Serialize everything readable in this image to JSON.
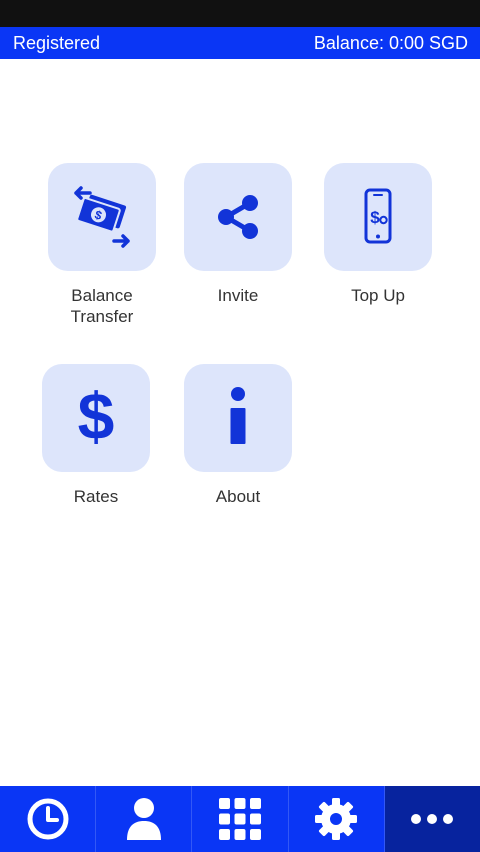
{
  "header": {
    "status": "Registered",
    "balance": "Balance: 0:00 SGD"
  },
  "tiles": [
    {
      "label_line1": "Balance",
      "label_line2": "Transfer",
      "icon": "money-transfer-icon"
    },
    {
      "label": "Invite",
      "icon": "share-icon"
    },
    {
      "label": "Top Up",
      "icon": "phone-dollar-icon"
    },
    {
      "label": "Rates",
      "icon": "dollar-icon"
    },
    {
      "label": "About",
      "icon": "info-icon"
    }
  ],
  "tabbar": {
    "items": [
      {
        "icon": "clock-icon"
      },
      {
        "icon": "person-icon"
      },
      {
        "icon": "dialpad-icon"
      },
      {
        "icon": "gear-icon"
      },
      {
        "icon": "more-icon",
        "active": true
      }
    ]
  },
  "colors": {
    "accent": "#0a36f5",
    "tile_bg": "#dde5fb",
    "active_tab": "#07239e",
    "status_bar": "#111111"
  }
}
